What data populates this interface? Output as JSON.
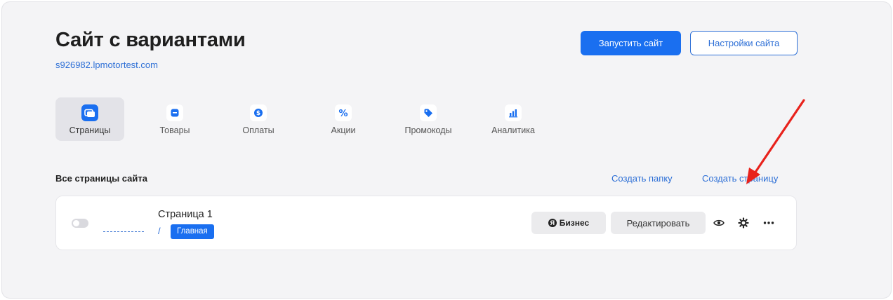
{
  "header": {
    "title": "Сайт с вариантами",
    "site_url": "s926982.lpmotortest.com",
    "launch_label": "Запустить сайт",
    "settings_label": "Настройки сайта"
  },
  "tabs": [
    {
      "label": "Страницы",
      "icon": "pages-icon",
      "active": true
    },
    {
      "label": "Товары",
      "icon": "products-icon",
      "active": false
    },
    {
      "label": "Оплаты",
      "icon": "payments-icon",
      "active": false
    },
    {
      "label": "Акции",
      "icon": "percent-icon",
      "active": false
    },
    {
      "label": "Промокоды",
      "icon": "tag-icon",
      "active": false
    },
    {
      "label": "Аналитика",
      "icon": "chart-icon",
      "active": false
    }
  ],
  "section": {
    "title": "Все страницы сайта",
    "create_folder": "Создать папку",
    "create_page": "Создать страницу"
  },
  "page_row": {
    "name": "Страница 1",
    "path": "/",
    "badge": "Главная",
    "biz_label": "Бизнес",
    "biz_logo_letter": "Я",
    "edit_label": "Редактировать"
  },
  "colors": {
    "accent": "#1a6ff0",
    "link": "#2d6fd6",
    "annotation_arrow": "#e8221c"
  }
}
